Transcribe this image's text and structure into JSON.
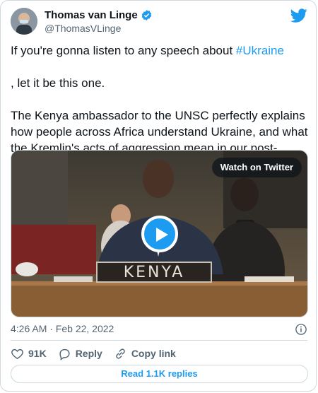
{
  "author": {
    "name": "Thomas van Linge",
    "handle": "@ThomasVLinge",
    "verified": true
  },
  "tweet": {
    "line1_before": "If you're gonna listen to any speech about ",
    "hashtag": "#Ukraine",
    "line1_after": ", let it be this one.",
    "paragraph2": "The Kenya ambassador to the UNSC perfectly explains how people across Africa understand Ukraine, and what the Kremlin's acts of aggression mean in our post-colonial world."
  },
  "media": {
    "watch_label": "Watch on Twitter",
    "placard": "KENYA"
  },
  "timestamp": "4:26 AM · Feb 22, 2022",
  "actions": {
    "likes": "91K",
    "reply_label": "Reply",
    "copy_link_label": "Copy link"
  },
  "replies_button": "Read 1.1K replies",
  "colors": {
    "accent": "#1d9bf0",
    "like": "#536471",
    "flag_blue": "#0057b7",
    "flag_yellow": "#ffd700"
  },
  "icons": [
    "verified-badge-icon",
    "twitter-bird-icon",
    "play-icon",
    "info-icon",
    "heart-icon",
    "reply-icon",
    "link-icon"
  ]
}
